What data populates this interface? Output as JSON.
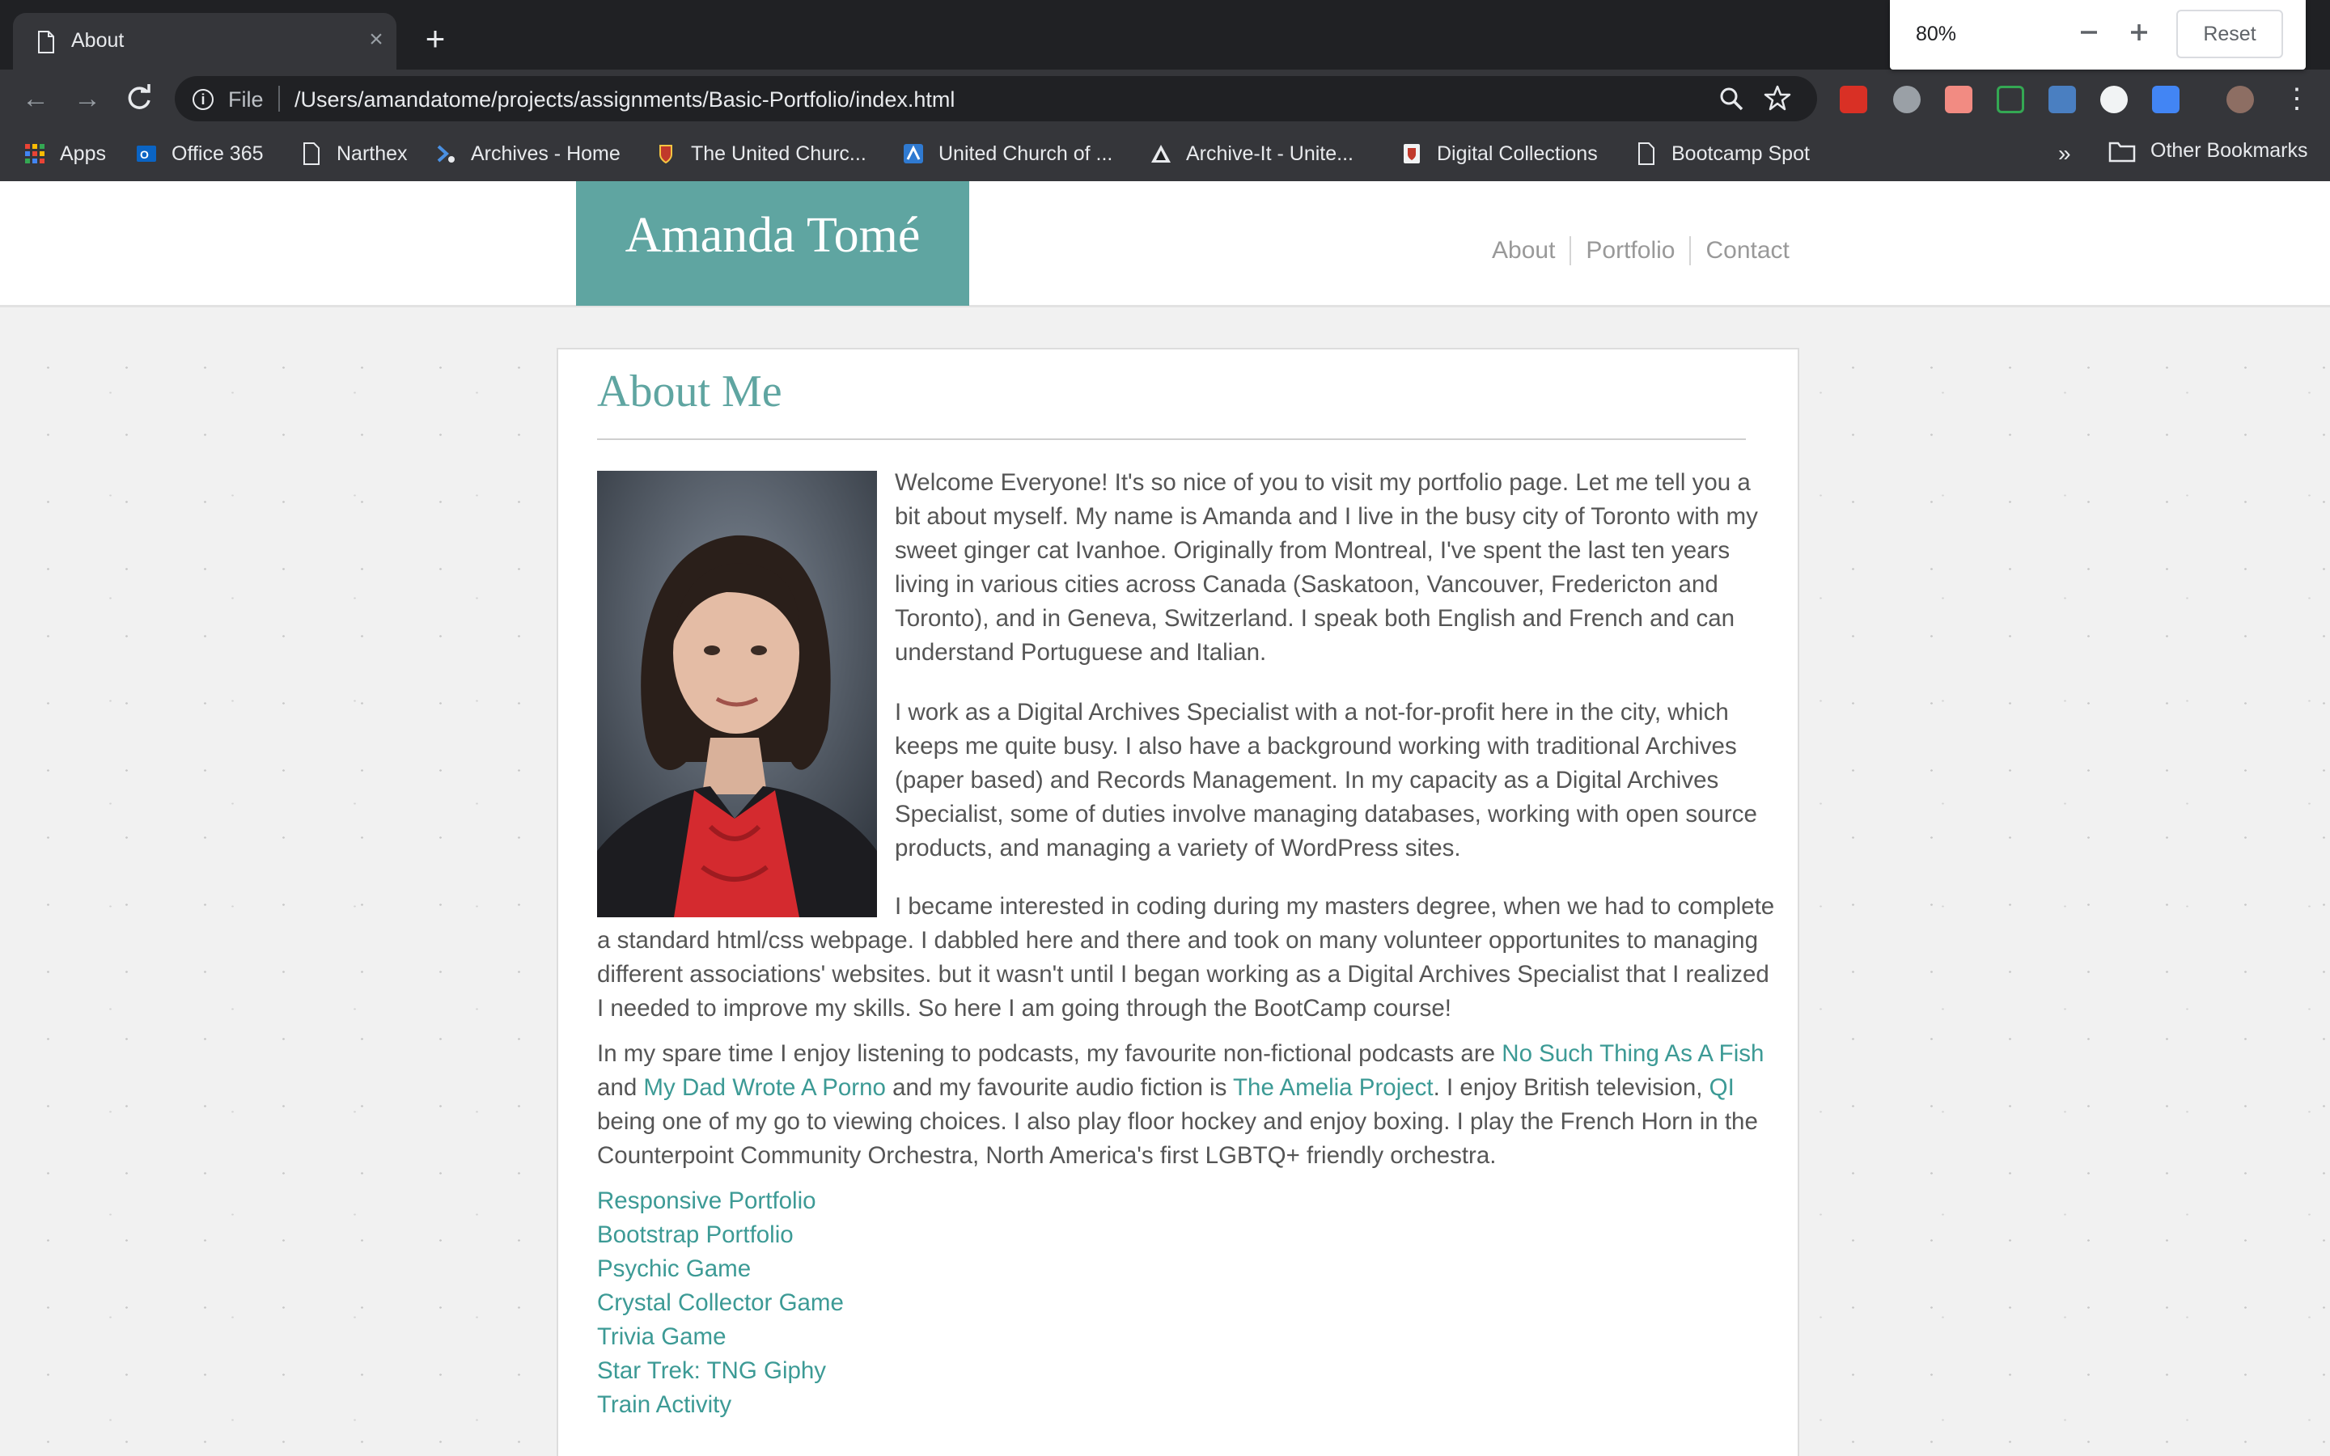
{
  "browser": {
    "tab_title": "About",
    "address_scheme": "File",
    "address_url": "/Users/amandatome/projects/assignments/Basic-Portfolio/index.html",
    "zoom": {
      "level": "80%",
      "reset_label": "Reset"
    },
    "bookmarks": [
      {
        "label": "Apps"
      },
      {
        "label": "Office 365"
      },
      {
        "label": "Narthex"
      },
      {
        "label": "Archives - Home"
      },
      {
        "label": "The United Churc..."
      },
      {
        "label": "United Church of ..."
      },
      {
        "label": "Archive-It - Unite..."
      },
      {
        "label": "Digital Collections"
      },
      {
        "label": "Bootcamp Spot"
      }
    ],
    "bookmarks_overflow": "»",
    "other_bookmarks": "Other Bookmarks"
  },
  "site": {
    "brand": "Amanda Tomé",
    "nav": [
      "About",
      "Portfolio",
      "Contact"
    ]
  },
  "about": {
    "title": "About Me",
    "p1": "Welcome Everyone! It's so nice of you to visit my portfolio page. Let me tell you a bit about myself. My name is Amanda and I live in the busy city of Toronto with my sweet ginger cat Ivanhoe. Originally from Montreal, I've spent the last ten years living in various cities across Canada (Saskatoon, Vancouver, Fredericton and Toronto), and in Geneva, Switzerland. I speak both English and French and can understand Portuguese and Italian.",
    "p2": "I work as a Digital Archives Specialist with a not-for-profit here in the city, which keeps me quite busy. I also have a background working with traditional Archives (paper based) and Records Management. In my capacity as a Digital Archives Specialist, some of duties involve managing databases, working with open source products, and managing a variety of WordPress sites.",
    "p3": "I became interested in coding during my masters degree, when we had to complete a standard html/css webpage. I dabbled here and there and took on many volunteer opportunites to managing different associations' websites. but it wasn't until I began working as a Digital Archives Specialist that I realized I needed to improve my skills. So here I am going through the BootCamp course!",
    "p4": {
      "t1": "In my spare time I enjoy listening to podcasts, my favourite non-fictional podcasts are ",
      "link1": "No Such Thing As A Fish",
      "t2": " and ",
      "link2": "My Dad Wrote A Porno",
      "t3": " and my favourite audio fiction is ",
      "link3": "The Amelia Project",
      "t4": ". I enjoy British television, ",
      "link4": "QI",
      "t5": " being one of my go to viewing choices. I also play floor hockey and enjoy boxing. I play the French Horn in the Counterpoint Community Orchestra, North America's first LGBTQ+ friendly orchestra."
    },
    "project_links": [
      "Responsive Portfolio",
      "Bootstrap Portfolio",
      "Psychic Game",
      "Crystal Collector Game",
      "Trivia Game",
      "Star Trek: TNG Giphy",
      "Train Activity"
    ]
  },
  "colors": {
    "accent": "#5fa5a1",
    "link": "#3c9a95",
    "body_text": "#555555",
    "chrome_dark": "#202124",
    "chrome_toolbar": "#35363a"
  },
  "icons": {
    "tab": "page-icon",
    "zoom_minus": "minus-icon",
    "zoom_plus": "plus-icon",
    "back": "back-arrow-icon",
    "forward": "forward-arrow-icon",
    "reload": "reload-icon",
    "site_info": "info-icon",
    "zoom": "magnifier-icon",
    "bookmark": "star-icon",
    "menu": "kebab-menu-icon",
    "other_bookmarks": "folder-icon"
  }
}
